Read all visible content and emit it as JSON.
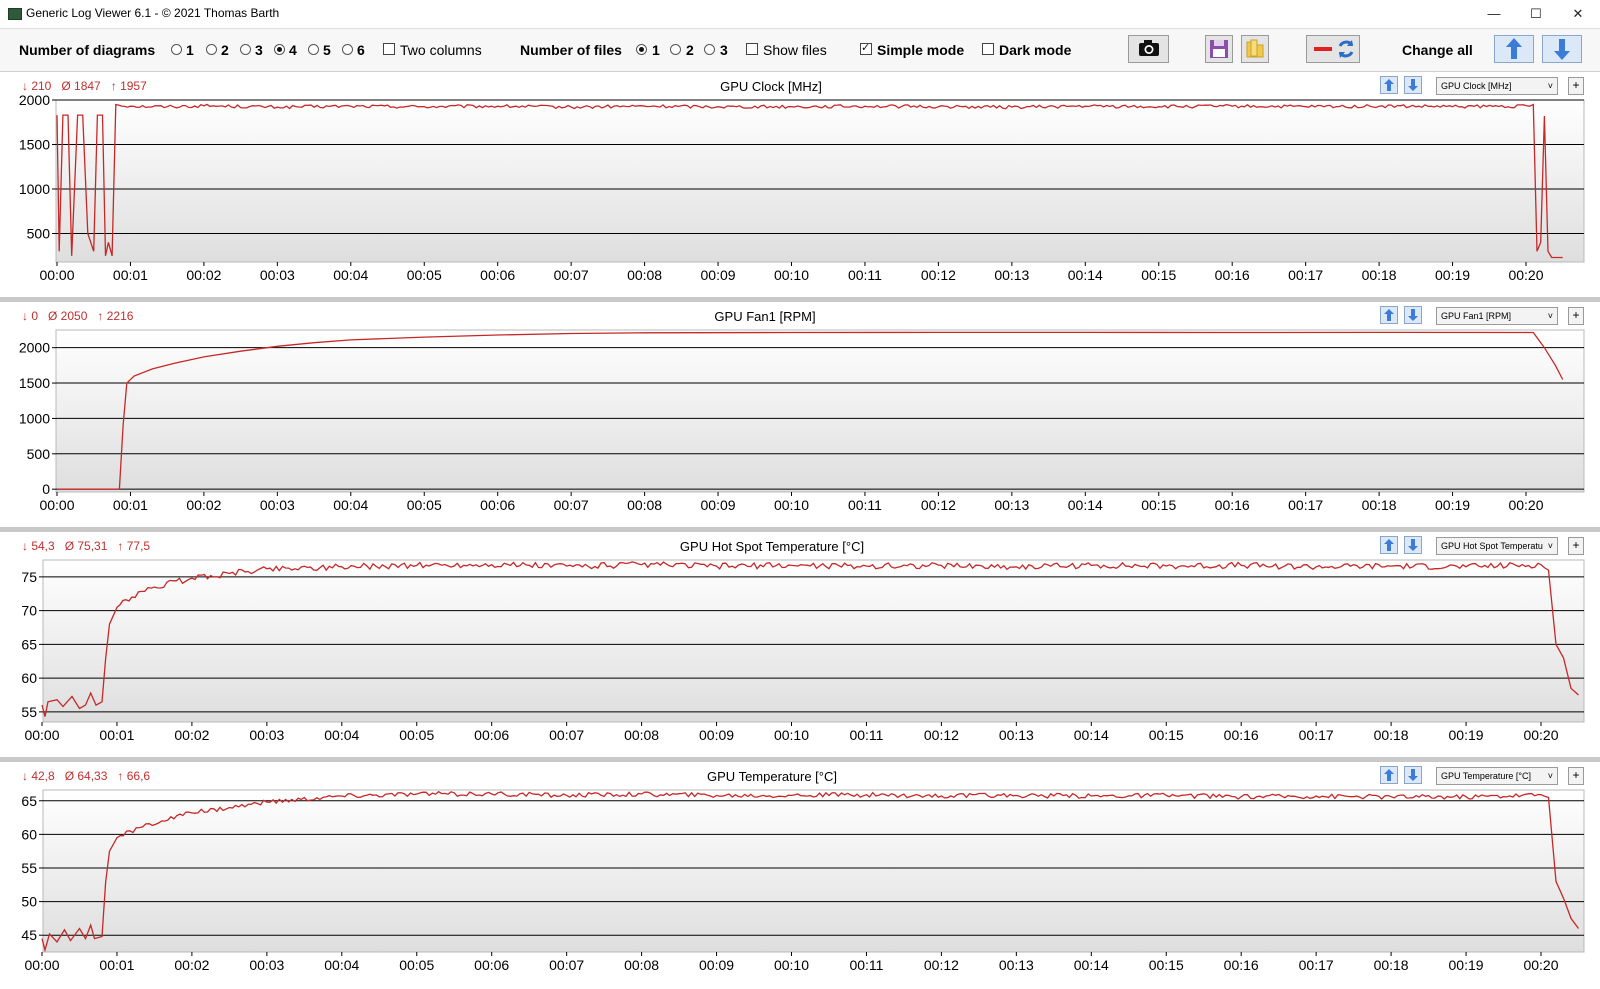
{
  "window": {
    "title": "Generic Log Viewer 6.1 - © 2021 Thomas Barth",
    "minimize": "—",
    "maximize": "☐",
    "close": "✕"
  },
  "toolbar": {
    "diagrams_label": "Number of diagrams",
    "diagram_options": [
      "1",
      "2",
      "3",
      "4",
      "5",
      "6"
    ],
    "diagram_selected": "4",
    "two_columns_label": "Two columns",
    "two_columns_checked": false,
    "files_label": "Number of files",
    "file_options": [
      "1",
      "2",
      "3"
    ],
    "file_selected": "1",
    "show_files_label": "Show files",
    "show_files_checked": false,
    "simple_mode_label": "Simple mode",
    "simple_mode_checked": true,
    "dark_mode_label": "Dark mode",
    "dark_mode_checked": false,
    "change_all_label": "Change all",
    "icons": [
      "camera-icon",
      "save-icon",
      "folder-icon",
      "line-refresh-icon",
      "arrow-up-icon",
      "arrow-down-icon"
    ]
  },
  "colors": {
    "series": "#c62828",
    "stats": "#c0302f",
    "grid": "#000000"
  },
  "chart_data": [
    {
      "type": "line",
      "title": "GPU Clock [MHz]",
      "select_value": "GPU Clock [MHz]",
      "stats": {
        "min": "↓ 210",
        "avg": "Ø 1847",
        "max": "↑ 1957"
      },
      "ylim": [
        180,
        2000
      ],
      "yticks": [
        500,
        1000,
        1500,
        2000
      ],
      "xlabels": [
        "00:00",
        "00:01",
        "00:02",
        "00:03",
        "00:04",
        "00:05",
        "00:06",
        "00:07",
        "00:08",
        "00:09",
        "00:10",
        "00:11",
        "00:12",
        "00:13",
        "00:14",
        "00:15",
        "00:16",
        "00:17",
        "00:18",
        "00:19",
        "00:20"
      ],
      "xmax": 20.6,
      "series": [
        {
          "points": [
            [
              0,
              1830
            ],
            [
              0.03,
              300
            ],
            [
              0.08,
              1830
            ],
            [
              0.15,
              1830
            ],
            [
              0.2,
              250
            ],
            [
              0.28,
              1830
            ],
            [
              0.35,
              1830
            ],
            [
              0.42,
              500
            ],
            [
              0.5,
              300
            ],
            [
              0.55,
              1830
            ],
            [
              0.62,
              1830
            ],
            [
              0.66,
              250
            ],
            [
              0.7,
              400
            ],
            [
              0.75,
              250
            ],
            [
              0.8,
              1950
            ],
            [
              1,
              1930
            ],
            [
              1.5,
              1925
            ],
            [
              2,
              1935
            ],
            [
              3,
              1920
            ],
            [
              4,
              1930
            ],
            [
              5,
              1925
            ],
            [
              6,
              1930
            ],
            [
              7,
              1920
            ],
            [
              8,
              1930
            ],
            [
              9,
              1925
            ],
            [
              10,
              1925
            ],
            [
              11,
              1930
            ],
            [
              12,
              1925
            ],
            [
              13,
              1920
            ],
            [
              14,
              1930
            ],
            [
              15,
              1925
            ],
            [
              16,
              1930
            ],
            [
              17,
              1925
            ],
            [
              18,
              1930
            ],
            [
              19,
              1925
            ],
            [
              20.05,
              1930
            ],
            [
              20.1,
              1950
            ],
            [
              20.15,
              300
            ],
            [
              20.2,
              400
            ],
            [
              20.25,
              1820
            ],
            [
              20.3,
              300
            ],
            [
              20.35,
              230
            ],
            [
              20.4,
              230
            ],
            [
              20.5,
              230
            ]
          ],
          "noise": 18,
          "noise_from": 0.8,
          "noise_to": 20.1
        }
      ]
    },
    {
      "type": "line",
      "title": "GPU Fan1 [RPM]",
      "select_value": "GPU Fan1 [RPM]",
      "stats": {
        "min": "↓ 0",
        "avg": "Ø 2050",
        "max": "↑ 2216"
      },
      "ylim": [
        -40,
        2250
      ],
      "yticks": [
        0,
        500,
        1000,
        1500,
        2000
      ],
      "xlabels": [
        "00:00",
        "00:01",
        "00:02",
        "00:03",
        "00:04",
        "00:05",
        "00:06",
        "00:07",
        "00:08",
        "00:09",
        "00:10",
        "00:11",
        "00:12",
        "00:13",
        "00:14",
        "00:15",
        "00:16",
        "00:17",
        "00:18",
        "00:19",
        "00:20"
      ],
      "xmax": 20.6,
      "series": [
        {
          "points": [
            [
              0,
              0
            ],
            [
              0.85,
              0
            ],
            [
              0.9,
              900
            ],
            [
              0.95,
              1500
            ],
            [
              1.05,
              1600
            ],
            [
              1.3,
              1700
            ],
            [
              1.6,
              1780
            ],
            [
              2,
              1870
            ],
            [
              2.5,
              1950
            ],
            [
              3,
              2020
            ],
            [
              3.5,
              2070
            ],
            [
              4,
              2110
            ],
            [
              5,
              2150
            ],
            [
              6,
              2180
            ],
            [
              7,
              2200
            ],
            [
              8,
              2210
            ],
            [
              10,
              2215
            ],
            [
              12,
              2216
            ],
            [
              14,
              2216
            ],
            [
              16,
              2215
            ],
            [
              18,
              2216
            ],
            [
              20.1,
              2214
            ],
            [
              20.25,
              2000
            ],
            [
              20.4,
              1750
            ],
            [
              20.5,
              1550
            ]
          ],
          "noise": 0,
          "noise_from": 0,
          "noise_to": 0
        }
      ]
    },
    {
      "type": "line",
      "title": "GPU Hot Spot Temperature [°C]",
      "select_value": "GPU Hot Spot Temperatu",
      "stats": {
        "min": "↓ 54,3",
        "avg": "Ø 75,31",
        "max": "↑ 77,5"
      },
      "ylim": [
        53.5,
        77.5
      ],
      "yticks": [
        55,
        60,
        65,
        70,
        75
      ],
      "xlabels": [
        "00:00",
        "00:01",
        "00:02",
        "00:03",
        "00:04",
        "00:05",
        "00:06",
        "00:07",
        "00:08",
        "00:09",
        "00:10",
        "00:11",
        "00:12",
        "00:13",
        "00:14",
        "00:15",
        "00:16",
        "00:17",
        "00:18",
        "00:19",
        "00:20"
      ],
      "xmax": 20.5,
      "series": [
        {
          "points": [
            [
              0,
              56
            ],
            [
              0.04,
              54.3
            ],
            [
              0.08,
              56.5
            ],
            [
              0.2,
              56.8
            ],
            [
              0.28,
              55.8
            ],
            [
              0.4,
              57.3
            ],
            [
              0.5,
              55.5
            ],
            [
              0.58,
              56
            ],
            [
              0.65,
              57.8
            ],
            [
              0.72,
              56
            ],
            [
              0.8,
              56.5
            ],
            [
              0.85,
              63
            ],
            [
              0.9,
              68
            ],
            [
              1,
              70.5
            ],
            [
              1.2,
              72
            ],
            [
              1.5,
              73.5
            ],
            [
              2,
              74.8
            ],
            [
              2.5,
              75.5
            ],
            [
              3,
              76.2
            ],
            [
              4,
              76.5
            ],
            [
              5,
              76.7
            ],
            [
              6,
              76.8
            ],
            [
              7,
              76.6
            ],
            [
              8,
              76.8
            ],
            [
              9,
              76.6
            ],
            [
              10,
              76.7
            ],
            [
              11,
              76.6
            ],
            [
              12,
              76.7
            ],
            [
              13,
              76.5
            ],
            [
              14,
              76.7
            ],
            [
              15,
              76.6
            ],
            [
              16,
              76.7
            ],
            [
              17,
              76.5
            ],
            [
              18,
              76.6
            ],
            [
              19,
              76.5
            ],
            [
              20,
              76.8
            ],
            [
              20.1,
              76
            ],
            [
              20.2,
              65
            ],
            [
              20.3,
              63
            ],
            [
              20.4,
              58.5
            ],
            [
              20.5,
              57.5
            ]
          ],
          "noise": 0.45,
          "noise_from": 1.0,
          "noise_to": 20.1
        }
      ]
    },
    {
      "type": "line",
      "title": "GPU Temperature [°C]",
      "select_value": "GPU Temperature [°C]",
      "stats": {
        "min": "↓ 42,8",
        "avg": "Ø 64,33",
        "max": "↑ 66,6"
      },
      "ylim": [
        42.5,
        66.6
      ],
      "yticks": [
        45,
        50,
        55,
        60,
        65
      ],
      "xlabels": [
        "00:00",
        "00:01",
        "00:02",
        "00:03",
        "00:04",
        "00:05",
        "00:06",
        "00:07",
        "00:08",
        "00:09",
        "00:10",
        "00:11",
        "00:12",
        "00:13",
        "00:14",
        "00:15",
        "00:16",
        "00:17",
        "00:18",
        "00:19",
        "00:20"
      ],
      "xmax": 20.5,
      "series": [
        {
          "points": [
            [
              0,
              44.5
            ],
            [
              0.04,
              42.8
            ],
            [
              0.1,
              45.2
            ],
            [
              0.2,
              44
            ],
            [
              0.3,
              45.8
            ],
            [
              0.38,
              44.2
            ],
            [
              0.5,
              46
            ],
            [
              0.58,
              44.5
            ],
            [
              0.65,
              46.5
            ],
            [
              0.7,
              44.5
            ],
            [
              0.8,
              44.8
            ],
            [
              0.85,
              53
            ],
            [
              0.9,
              57.5
            ],
            [
              1,
              59.5
            ],
            [
              1.3,
              61
            ],
            [
              1.6,
              62
            ],
            [
              2,
              63.2
            ],
            [
              2.5,
              64
            ],
            [
              3,
              64.8
            ],
            [
              4,
              65.7
            ],
            [
              5,
              66
            ],
            [
              6,
              66
            ],
            [
              7,
              65.8
            ],
            [
              8,
              66
            ],
            [
              9,
              65.8
            ],
            [
              10,
              65.8
            ],
            [
              11,
              65.9
            ],
            [
              12,
              65.7
            ],
            [
              13,
              65.8
            ],
            [
              14,
              65.7
            ],
            [
              15,
              65.8
            ],
            [
              16,
              65.6
            ],
            [
              17,
              65.7
            ],
            [
              18,
              65.6
            ],
            [
              19,
              65.6
            ],
            [
              20,
              65.9
            ],
            [
              20.1,
              65.5
            ],
            [
              20.2,
              53
            ],
            [
              20.3,
              50.5
            ],
            [
              20.4,
              47.5
            ],
            [
              20.5,
              46
            ]
          ],
          "noise": 0.35,
          "noise_from": 1.0,
          "noise_to": 20.1
        }
      ]
    }
  ]
}
